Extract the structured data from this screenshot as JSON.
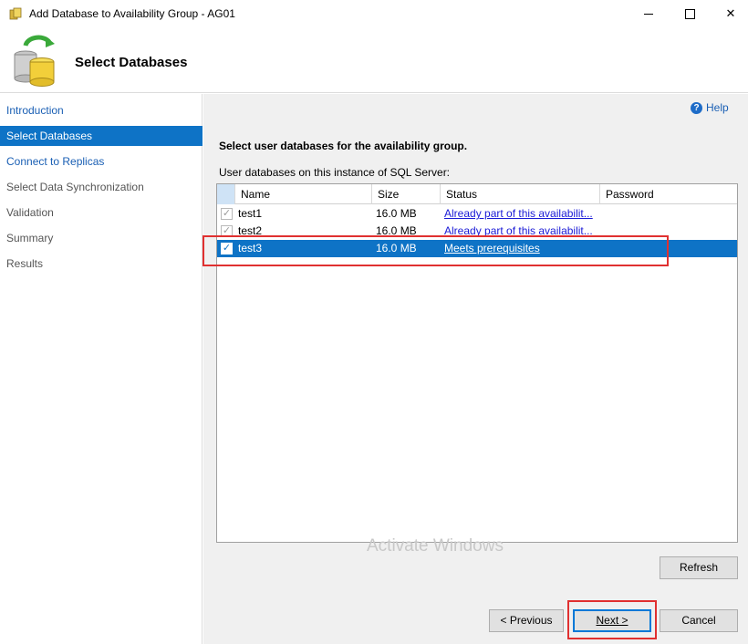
{
  "window": {
    "title": "Add Database to Availability Group - AG01"
  },
  "header": {
    "title": "Select Databases"
  },
  "nav": {
    "items": [
      {
        "label": "Introduction",
        "state": "link"
      },
      {
        "label": "Select Databases",
        "state": "active"
      },
      {
        "label": "Connect to Replicas",
        "state": "link"
      },
      {
        "label": "Select Data Synchronization",
        "state": "gray"
      },
      {
        "label": "Validation",
        "state": "gray"
      },
      {
        "label": "Summary",
        "state": "gray"
      },
      {
        "label": "Results",
        "state": "gray"
      }
    ]
  },
  "main": {
    "help_label": "Help",
    "heading": "Select user databases for the availability group.",
    "grid_label": "User databases on this instance of SQL Server:",
    "columns": [
      "Name",
      "Size",
      "Status",
      "Password"
    ],
    "rows": [
      {
        "name": "test1",
        "size": "16.0 MB",
        "status": "Already part of this availabilit...",
        "checked": true,
        "selected": false
      },
      {
        "name": "test2",
        "size": "16.0 MB",
        "status": "Already part of this availabilit...",
        "checked": true,
        "selected": false
      },
      {
        "name": "test3",
        "size": "16.0 MB",
        "status": "Meets prerequisites",
        "checked": true,
        "selected": true
      }
    ],
    "refresh_label": "Refresh"
  },
  "footer": {
    "previous_label": "< Previous",
    "next_label": "Next >",
    "cancel_label": "Cancel",
    "watermark": "Activate Windows"
  },
  "colors": {
    "accent": "#0e73c6",
    "highlight_box": "#e03030",
    "link": "#1a5fb4"
  }
}
